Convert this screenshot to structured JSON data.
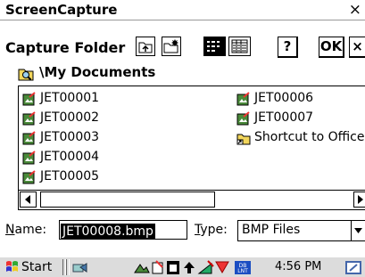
{
  "window": {
    "title": "ScreenCapture",
    "close_label": "×"
  },
  "toolbar": {
    "label": "Capture Folder",
    "help_label": "?",
    "ok_label": "OK",
    "close_label": "×"
  },
  "path": {
    "text": "\\My Documents"
  },
  "files": [
    {
      "name": "JET00001",
      "icon": "image-file-icon"
    },
    {
      "name": "JET00002",
      "icon": "image-file-icon"
    },
    {
      "name": "JET00003",
      "icon": "image-file-icon"
    },
    {
      "name": "JET00004",
      "icon": "image-file-icon"
    },
    {
      "name": "JET00005",
      "icon": "image-file-icon"
    },
    {
      "name": "JET00006",
      "icon": "image-file-icon"
    },
    {
      "name": "JET00007",
      "icon": "image-file-icon"
    },
    {
      "name": "Shortcut to Office",
      "icon": "folder-shortcut-icon"
    }
  ],
  "name_field": {
    "label_u": "N",
    "label_rest": "ame:",
    "value": "JET00008.bmp"
  },
  "type_field": {
    "label_u": "T",
    "label_rest": "ype:",
    "value": "BMP Files"
  },
  "taskbar": {
    "start_label": "Start",
    "clock": "4:56 PM"
  }
}
